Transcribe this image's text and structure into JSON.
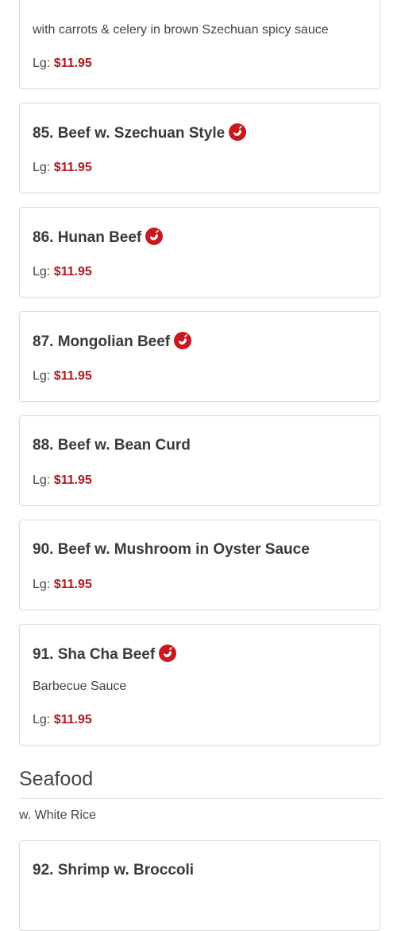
{
  "cards": [
    {
      "title": "",
      "desc": "with carrots & celery in brown Szechuan spicy sauce",
      "price_label": "Lg:",
      "price": "$11.95"
    },
    {
      "title": "85. Beef w. Szechuan Style",
      "price_label": "Lg:",
      "price": "$11.95",
      "spicy": true
    },
    {
      "title": "86. Hunan Beef",
      "price_label": "Lg:",
      "price": "$11.95",
      "spicy": true
    },
    {
      "title": "87. Mongolian Beef",
      "price_label": "Lg:",
      "price": "$11.95",
      "spicy": true
    },
    {
      "title": "88. Beef w. Bean Curd",
      "price_label": "Lg:",
      "price": "$11.95"
    },
    {
      "title": "90. Beef w. Mushroom in Oyster Sauce",
      "price_label": "Lg:",
      "price": "$11.95"
    },
    {
      "title": "91. Sha Cha Beef",
      "desc": "Barbecue Sauce",
      "price_label": "Lg:",
      "price": "$11.95",
      "spicy": true
    },
    {
      "title": "92. Shrimp w. Broccoli"
    }
  ],
  "section": {
    "title": "Seafood",
    "note": "w. White Rice"
  },
  "colors": {
    "price": "#b0181e",
    "spicy_icon": "#c8191f"
  },
  "icons": {
    "spicy": "chili-pepper-icon"
  }
}
